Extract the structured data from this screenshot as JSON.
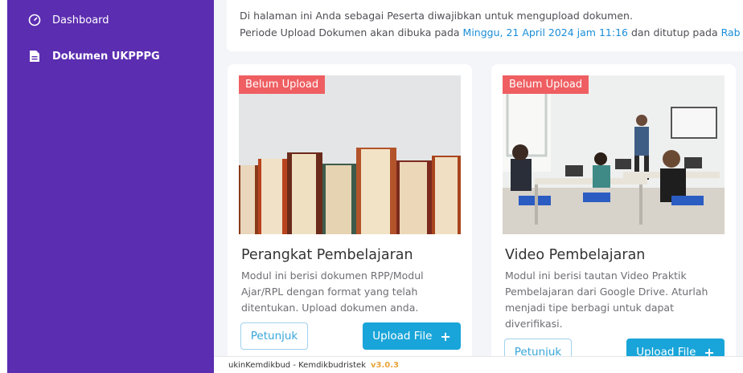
{
  "sidebar": {
    "items": [
      {
        "label": "Dashboard",
        "icon": "gauge-icon"
      },
      {
        "label": "Dokumen UKPPPG",
        "icon": "document-icon"
      }
    ]
  },
  "info": {
    "line1": "Di halaman ini Anda sebagai Peserta diwajibkan untuk mengupload dokumen.",
    "line2_prefix": "Periode Upload Dokumen akan dibuka pada ",
    "open_date": "Minggu, 21 April 2024 jam 11:16",
    "line2_middle": " dan ditutup pada ",
    "close_date_partial": "Rab"
  },
  "cards": [
    {
      "badge": "Belum Upload",
      "title": "Perangkat Pembelajaran",
      "description": "Modul ini berisi dokumen RPP/Modul Ajar/RPL dengan format yang telah ditentukan. Upload dokumen anda.",
      "guide_label": "Petunjuk",
      "upload_label": "Upload File",
      "image": "books-image"
    },
    {
      "badge": "Belum Upload",
      "title": "Video Pembelajaran",
      "description": "Modul ini berisi tautan Video Praktik Pembelajaran dari Google Drive. Aturlah menjadi tipe berbagi untuk dapat diverifikasi.",
      "guide_label": "Petunjuk",
      "upload_label": "Upload File",
      "image": "classroom-image"
    }
  ],
  "footer": {
    "text": "ukinKemdikbud - Kemdikbudristek",
    "version": "v3.0.3"
  },
  "colors": {
    "sidebar": "#5b2db0",
    "badge": "#ef5f62",
    "primary": "#19a5d9",
    "highlight": "#1a8ed8",
    "version": "#e8a43a"
  }
}
